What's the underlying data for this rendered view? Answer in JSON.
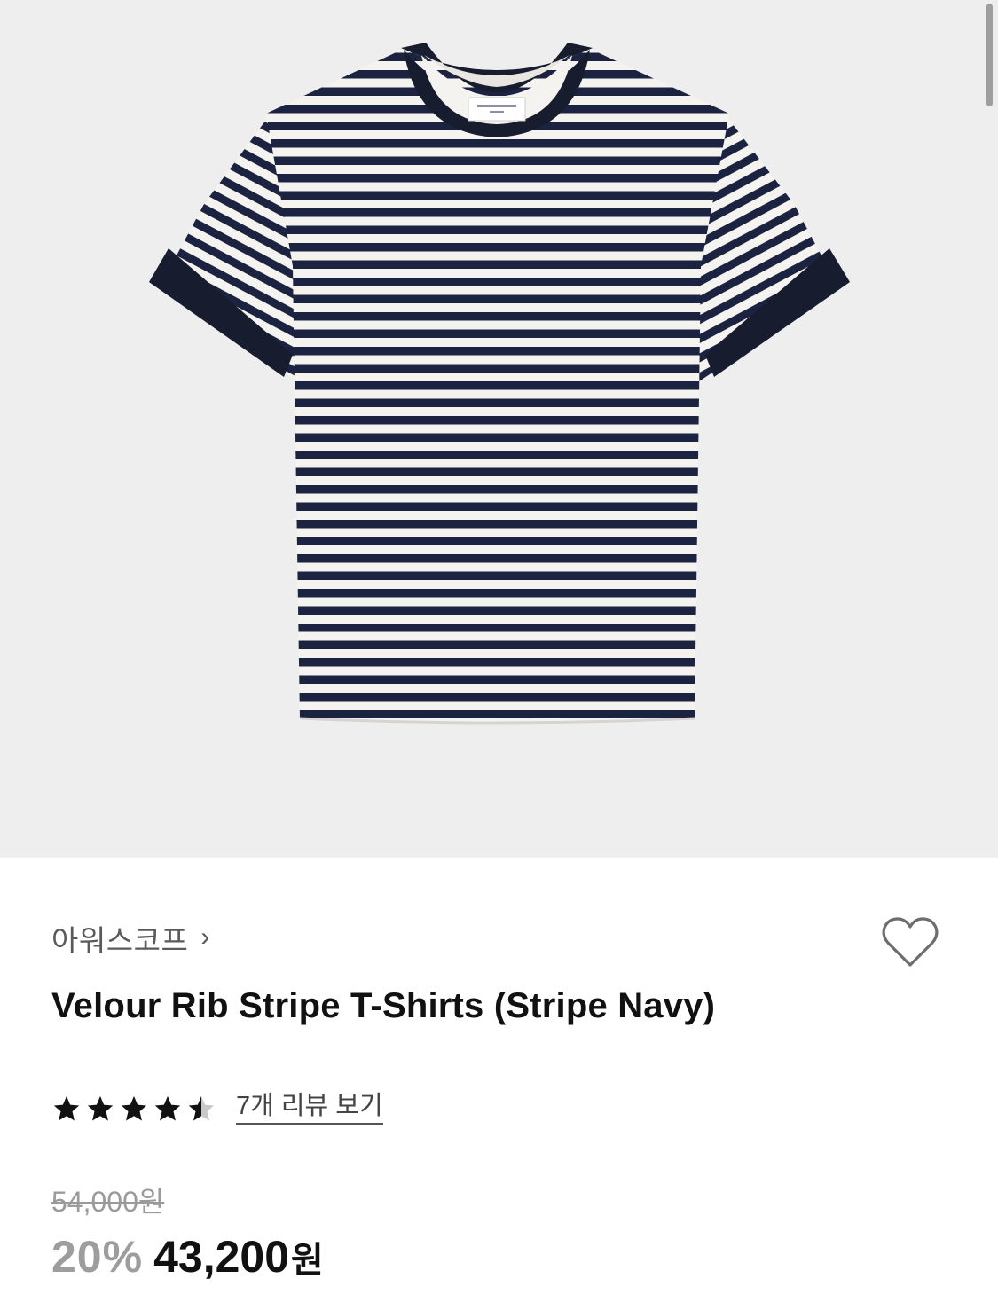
{
  "product": {
    "brand": "아워스코프",
    "brand_chevron": "›",
    "title": "Velour Rib Stripe T-Shirts (Stripe Navy)",
    "rating": 4.5,
    "review_link": "7개 리뷰 보기",
    "original_price": "54,000원",
    "discount": "20%",
    "sale_price": "43,200",
    "sale_currency": "원"
  },
  "colors": {
    "hero_bg": "#eeeeee",
    "navy": "#1c2340",
    "stripe_white": "#f5f3ef",
    "text": "#111111",
    "muted": "#9a9a9a"
  },
  "icons": [
    "heart-outline-icon",
    "star-icon",
    "half-star-icon",
    "chevron-right-icon"
  ]
}
